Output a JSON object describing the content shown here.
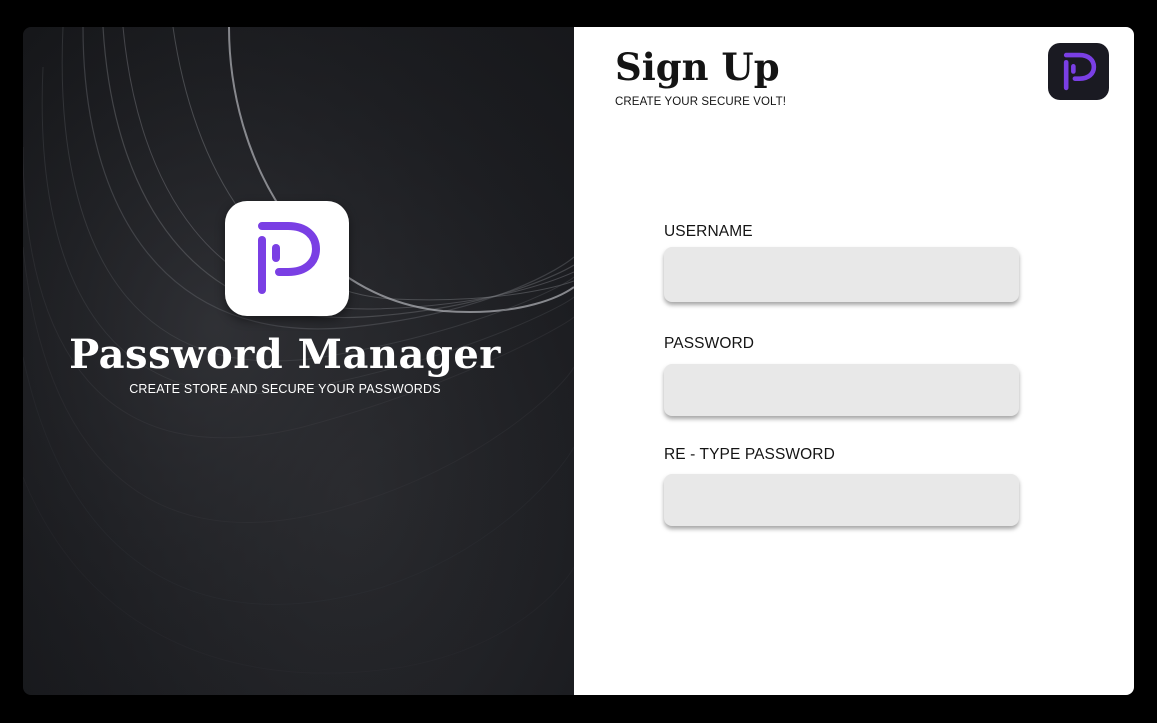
{
  "brand": {
    "app_name": "Password Manager",
    "tagline": "CREATE STORE AND SECURE YOUR PASSWORDS",
    "logo_icon": "purple-p-logo-icon",
    "accent_color": "#7a3fe4"
  },
  "signup": {
    "title": "Sign Up",
    "subtitle": "CREATE YOUR SECURE VOLT!",
    "corner_logo_icon": "purple-p-logo-icon"
  },
  "form": {
    "fields": [
      {
        "label": "USERNAME",
        "value": "",
        "placeholder": ""
      },
      {
        "label": "PASSWORD",
        "value": "",
        "placeholder": ""
      },
      {
        "label": "RE - TYPE PASSWORD",
        "value": "",
        "placeholder": ""
      }
    ]
  }
}
